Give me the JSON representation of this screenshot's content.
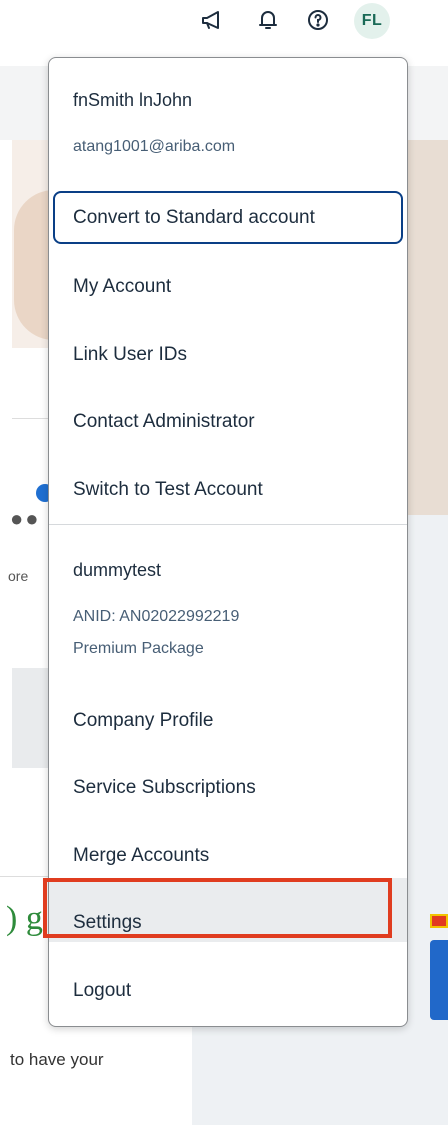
{
  "header": {
    "icons": {
      "announcements": "megaphone-icon",
      "notifications": "bell-icon",
      "help": "help-icon"
    },
    "avatar_initials": "FL"
  },
  "user_menu": {
    "user_name": "fnSmith lnJohn",
    "user_email": "atang1001@ariba.com",
    "convert_button_label": "Convert to Standard account",
    "account_items": [
      {
        "label": "My Account"
      },
      {
        "label": "Link User IDs"
      },
      {
        "label": "Contact Administrator"
      },
      {
        "label": "Switch to Test Account"
      }
    ],
    "company_name": "dummytest",
    "company_anid": "ANID: AN02022992219",
    "company_package": "Premium Package",
    "company_items": [
      {
        "label": "Company Profile"
      },
      {
        "label": "Service Subscriptions"
      },
      {
        "label": "Merge Accounts"
      },
      {
        "label": "Settings"
      },
      {
        "label": "Logout"
      }
    ]
  },
  "background": {
    "partial_text_1": "ore",
    "partial_text_2": ") g",
    "partial_text_3": "to have your"
  },
  "colors": {
    "highlight": "#e03c1f",
    "focus_border": "#0a3f86",
    "avatar_bg": "#e3f1ec",
    "avatar_text": "#1a6a57"
  }
}
